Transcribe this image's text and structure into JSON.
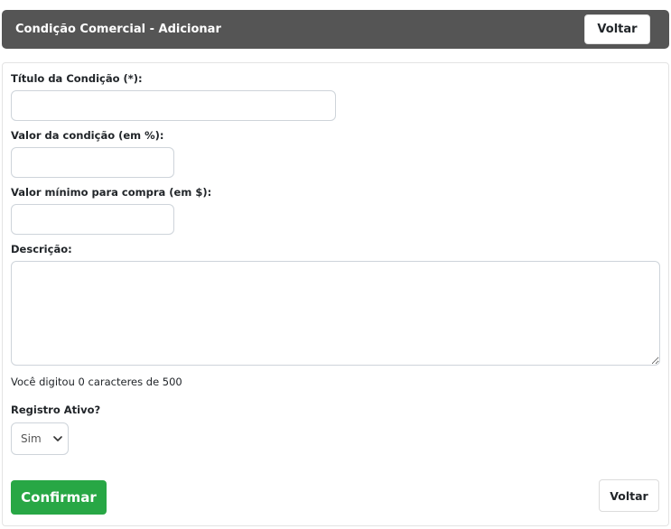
{
  "header": {
    "title": "Condição Comercial - Adicionar",
    "back_label": "Voltar"
  },
  "form": {
    "title_field": {
      "label": "Título da Condição (*):",
      "value": ""
    },
    "value_field": {
      "label": "Valor da condição (em %):",
      "value": ""
    },
    "min_purchase_field": {
      "label": "Valor mínimo para compra (em $):",
      "value": ""
    },
    "description_field": {
      "label": "Descrição:",
      "value": ""
    },
    "char_counter": "Você digitou 0 caracteres de 500",
    "active_field": {
      "label": "Registro Ativo?",
      "selected": "Sim"
    }
  },
  "actions": {
    "confirm_label": "Confirmar",
    "back_label": "Voltar"
  },
  "colors": {
    "header_bg": "#555555",
    "confirm_bg": "#28a745"
  },
  "icons": {
    "select_chevron": "chevron-down-icon"
  }
}
